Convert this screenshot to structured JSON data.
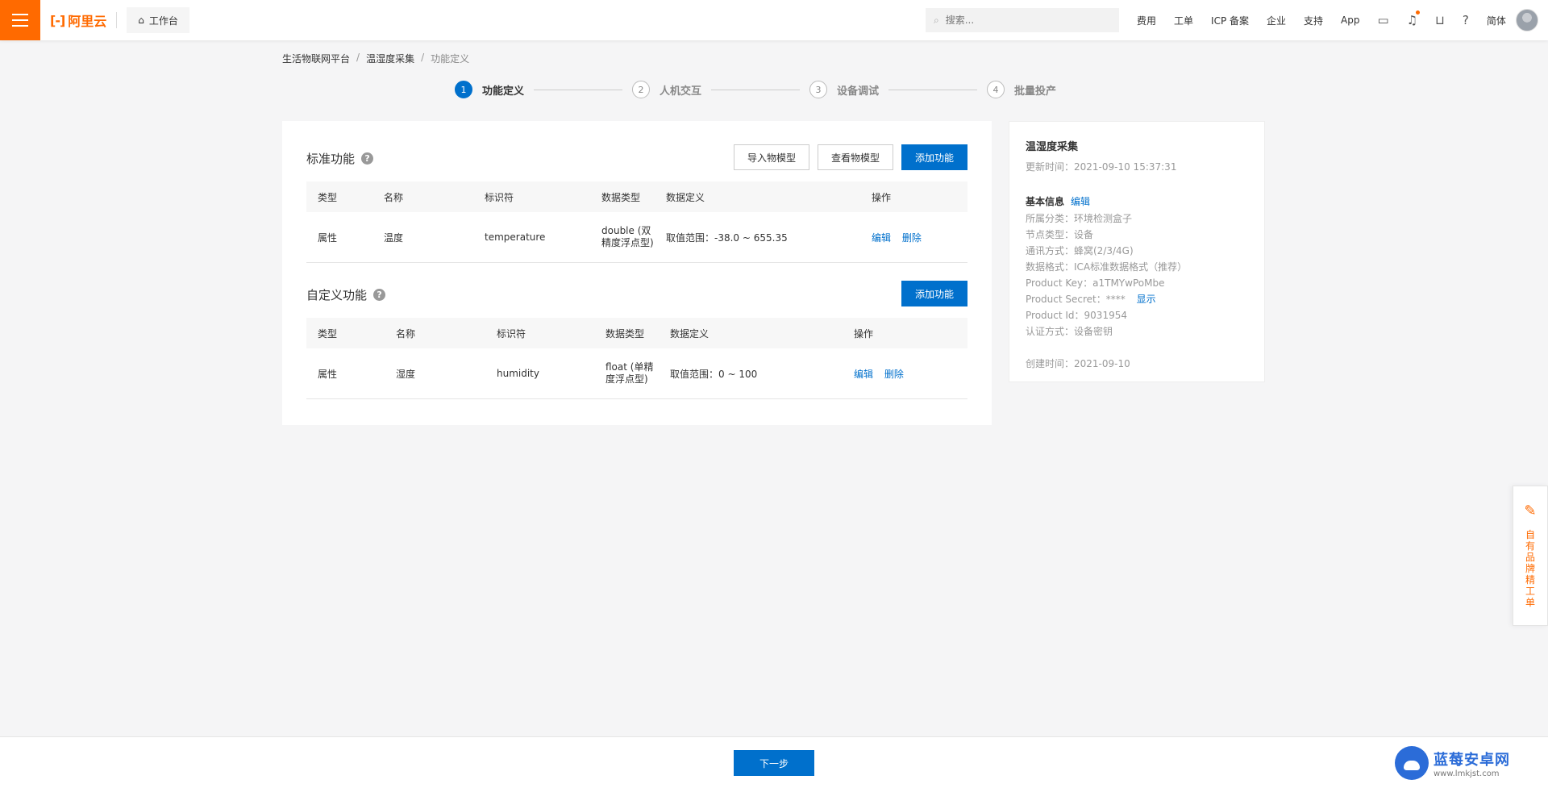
{
  "topbar": {
    "logo_text": "阿里云",
    "workbench_label": "工作台",
    "search_placeholder": "搜索...",
    "links": [
      "费用",
      "工单",
      "ICP 备案",
      "企业",
      "支持",
      "App"
    ],
    "lang_label": "简体",
    "icons": [
      "terminal-icon",
      "bell-icon",
      "cart-icon",
      "help-circle-icon"
    ],
    "accent_color": "#ff6a00"
  },
  "breadcrumb": {
    "items": [
      "生活物联网平台",
      "温湿度采集",
      "功能定义"
    ]
  },
  "steps": [
    {
      "num": "1",
      "label": "功能定义",
      "active": true
    },
    {
      "num": "2",
      "label": "人机交互",
      "active": false
    },
    {
      "num": "3",
      "label": "设备调试",
      "active": false
    },
    {
      "num": "4",
      "label": "批量投产",
      "active": false
    }
  ],
  "standard": {
    "title": "标准功能",
    "buttons": {
      "import": "导入物模型",
      "view": "查看物模型",
      "add": "添加功能"
    },
    "headers": [
      "类型",
      "名称",
      "标识符",
      "数据类型",
      "数据定义",
      "操作"
    ],
    "rows": [
      {
        "type": "属性",
        "name": "温度",
        "identifier": "temperature",
        "data_type": "double (双精度浮点型)",
        "definition": "取值范围：-38.0 ~ 655.35",
        "edit": "编辑",
        "delete": "删除"
      }
    ]
  },
  "custom": {
    "title": "自定义功能",
    "add_button": "添加功能",
    "headers": [
      "类型",
      "名称",
      "标识符",
      "数据类型",
      "数据定义",
      "操作"
    ],
    "rows": [
      {
        "type": "属性",
        "name": "湿度",
        "identifier": "humidity",
        "data_type": "float (单精度浮点型)",
        "definition": "取值范围：0 ~ 100",
        "edit": "编辑",
        "delete": "删除"
      }
    ]
  },
  "info": {
    "title": "温湿度采集",
    "updated": "更新时间：2021-09-10 15:37:31",
    "basic_label": "基本信息",
    "basic_edit": "编辑",
    "lines": [
      "所属分类：环境检测盒子",
      "节点类型：设备",
      "通讯方式：蜂窝(2/3/4G)",
      "数据格式：ICA标准数据格式（推荐）",
      "Product Key：a1TMYwPoMbe"
    ],
    "secret_label": "Product Secret：****",
    "secret_show": "显示",
    "product_id": "Product Id：9031954",
    "auth": "认证方式：设备密钥",
    "created": "创建时间：2021-09-10"
  },
  "footer": {
    "next_label": "下一步"
  },
  "float_tab": {
    "label": "自有品牌精工单"
  },
  "watermark": {
    "name": "蓝莓安卓网",
    "url": "www.lmkjst.com"
  }
}
